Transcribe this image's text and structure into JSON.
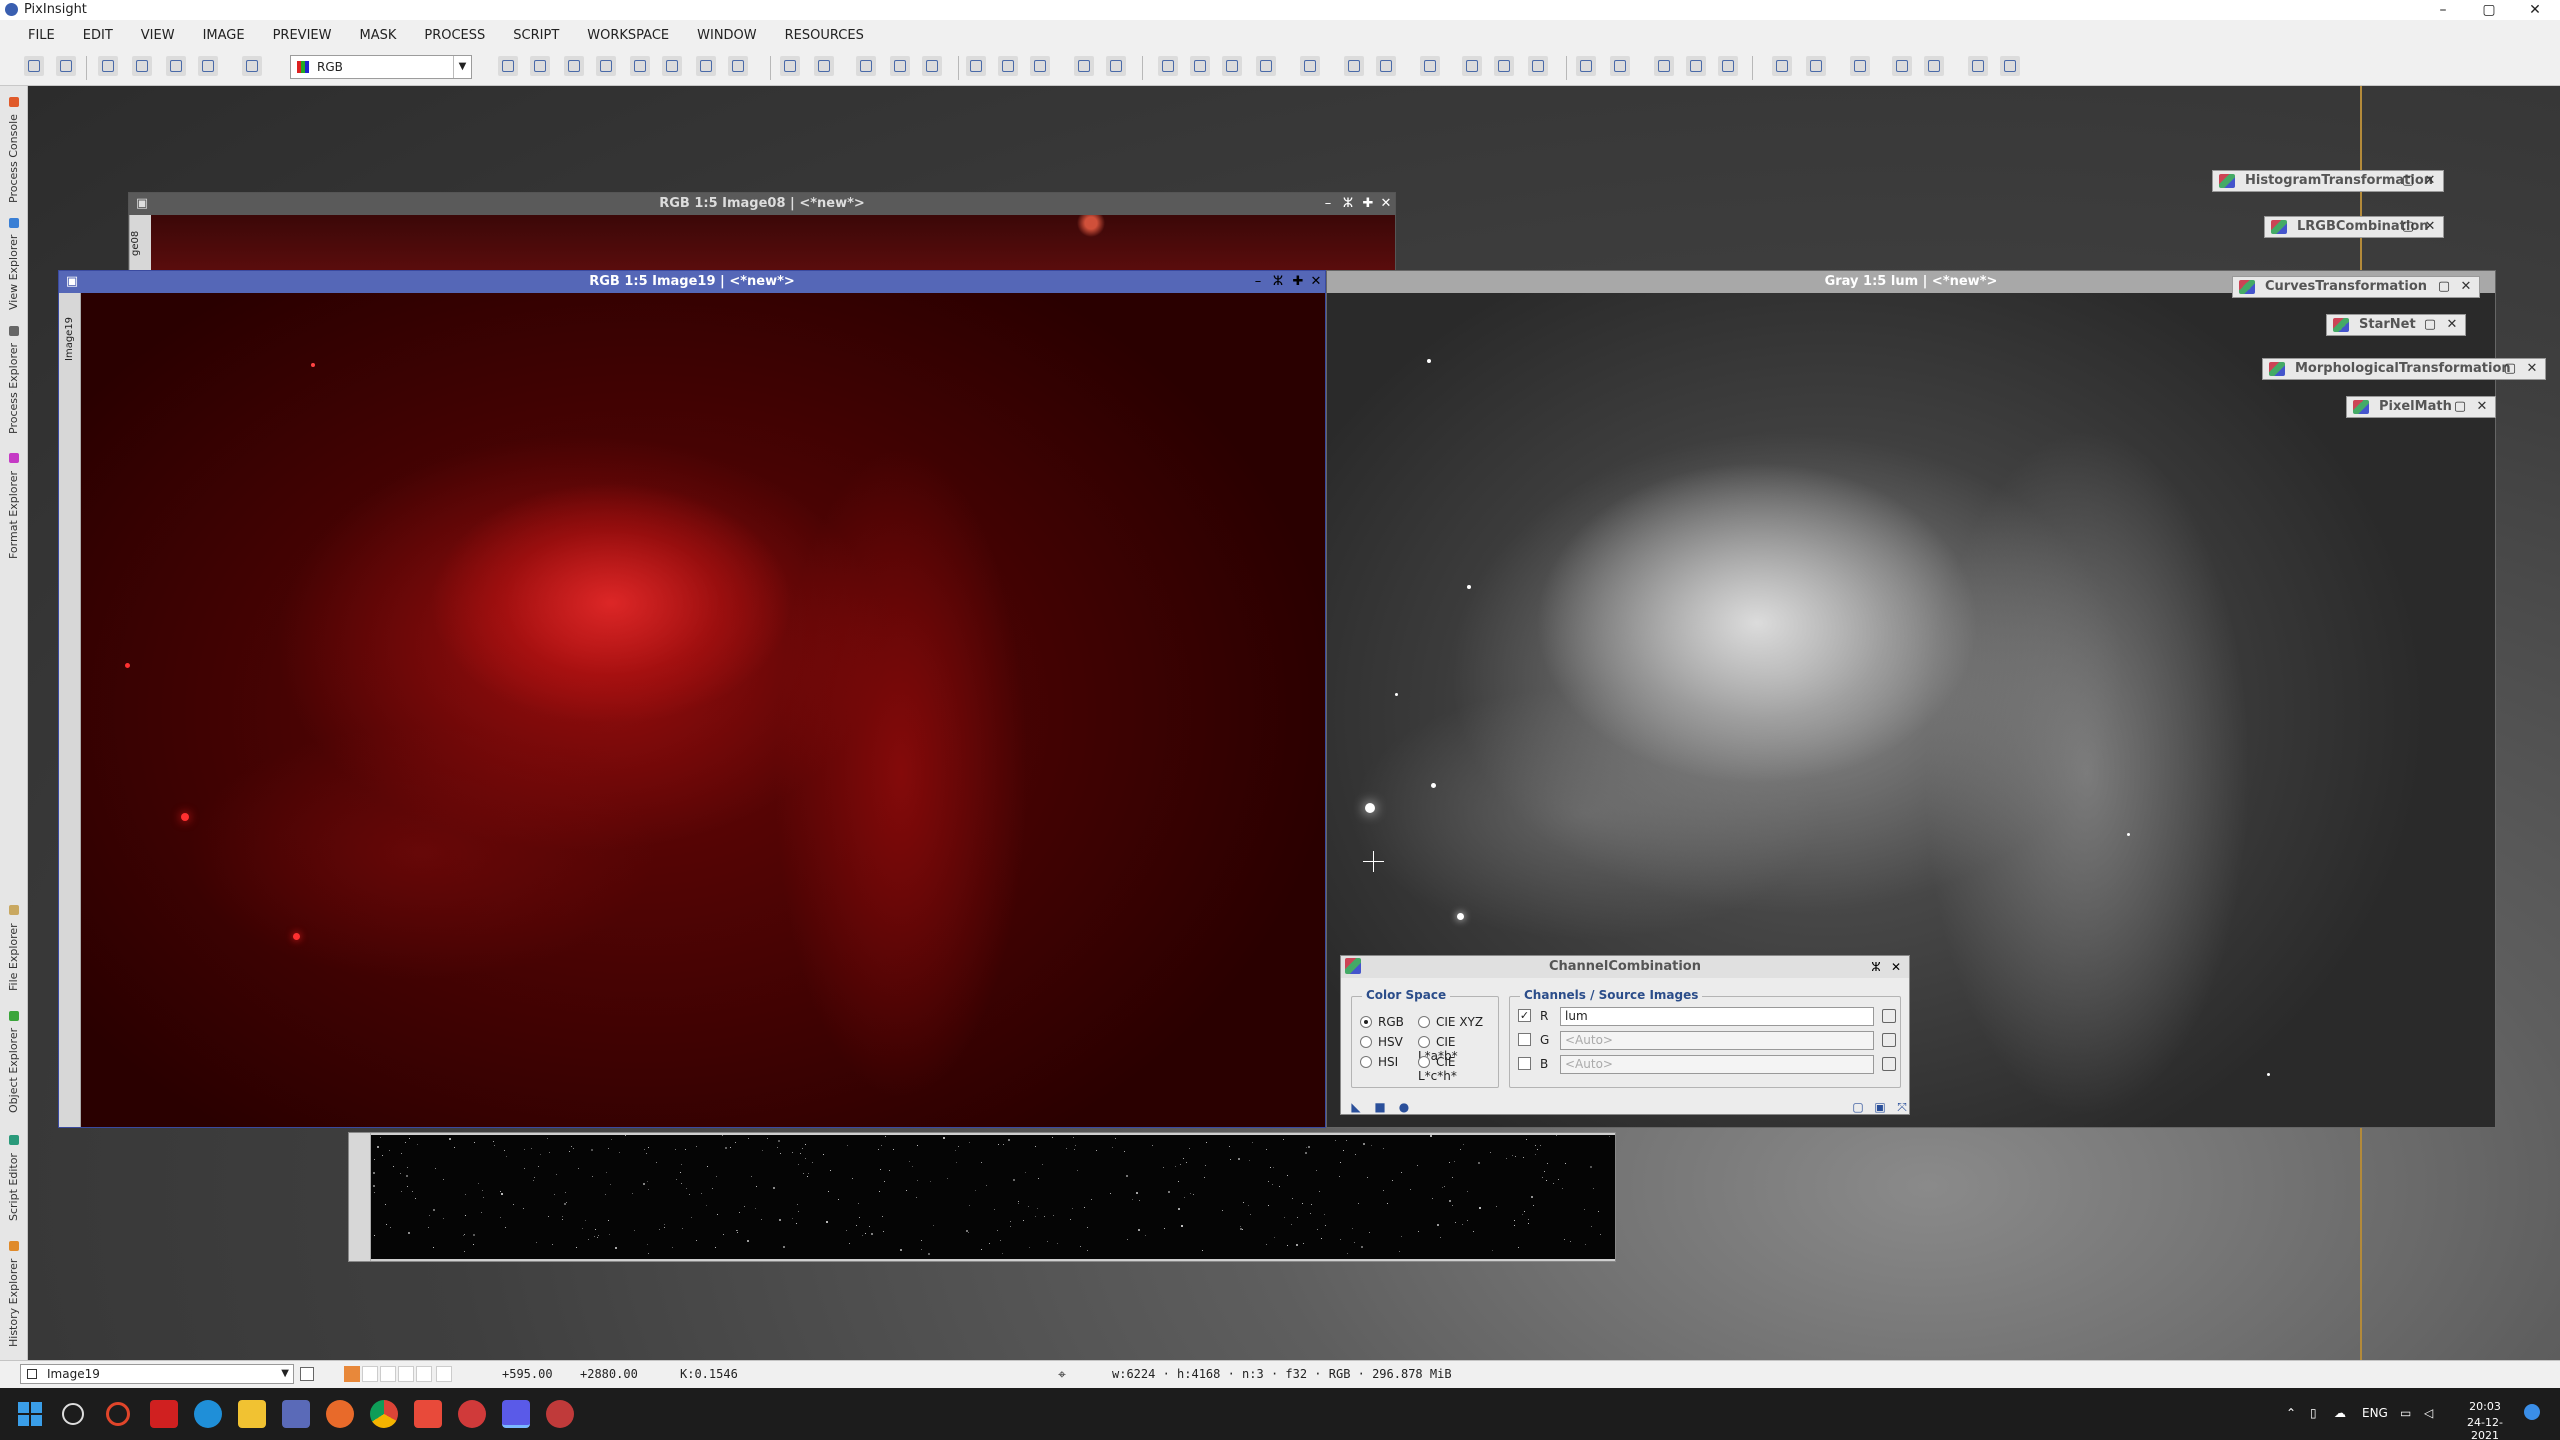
{
  "app": {
    "title": "PixInsight"
  },
  "menu": [
    "FILE",
    "EDIT",
    "VIEW",
    "IMAGE",
    "PREVIEW",
    "MASK",
    "PROCESS",
    "SCRIPT",
    "WORKSPACE",
    "WINDOW",
    "RESOURCES"
  ],
  "toolbar": {
    "color_space_value": "RGB"
  },
  "sidebar_tabs": [
    "Process Console",
    "View Explorer",
    "Process Explorer",
    "Format Explorer",
    "File Explorer",
    "Object Explorer",
    "Script Editor",
    "History Explorer"
  ],
  "windows": {
    "image08": {
      "title": "RGB 1:5 Image08 | <*new*>",
      "side_id": "ge08"
    },
    "image19": {
      "title": "RGB 1:5 Image19 | <*new*>",
      "side_id": "Image19"
    },
    "lum": {
      "title": "Gray 1:5 lum | <*new*>"
    }
  },
  "iconized_processes": [
    "HistogramTransformation",
    "LRGBCombination",
    "CurvesTransformation",
    "StarNet",
    "MorphologicalTransformation",
    "PixelMath"
  ],
  "channel_combination": {
    "title": "ChannelCombination",
    "color_space_label": "Color Space",
    "options": [
      "RGB",
      "CIE XYZ",
      "HSV",
      "CIE L*a*b*",
      "HSI",
      "CIE L*c*h*"
    ],
    "selected": "RGB",
    "channels_label": "Channels / Source Images",
    "channels": [
      {
        "id": "R",
        "checked": true,
        "value": "lum",
        "placeholder": ""
      },
      {
        "id": "G",
        "checked": false,
        "value": "",
        "placeholder": "<Auto>"
      },
      {
        "id": "B",
        "checked": false,
        "value": "",
        "placeholder": "<Auto>"
      }
    ],
    "check_mark": "✓"
  },
  "status": {
    "view": "Image19",
    "x": "+595.00",
    "y": "+2880.00",
    "k": "K:0.1546",
    "info": "w:6224 · h:4168 · n:3 · f32 · RGB · 296.878 MiB"
  },
  "taskbar": {
    "lang": "ENG",
    "time": "20:03",
    "date": "24-12-2021"
  },
  "window_controls": {
    "minimize": "–",
    "shade": "ⵣ",
    "maximize": "✚",
    "close": "✕"
  }
}
